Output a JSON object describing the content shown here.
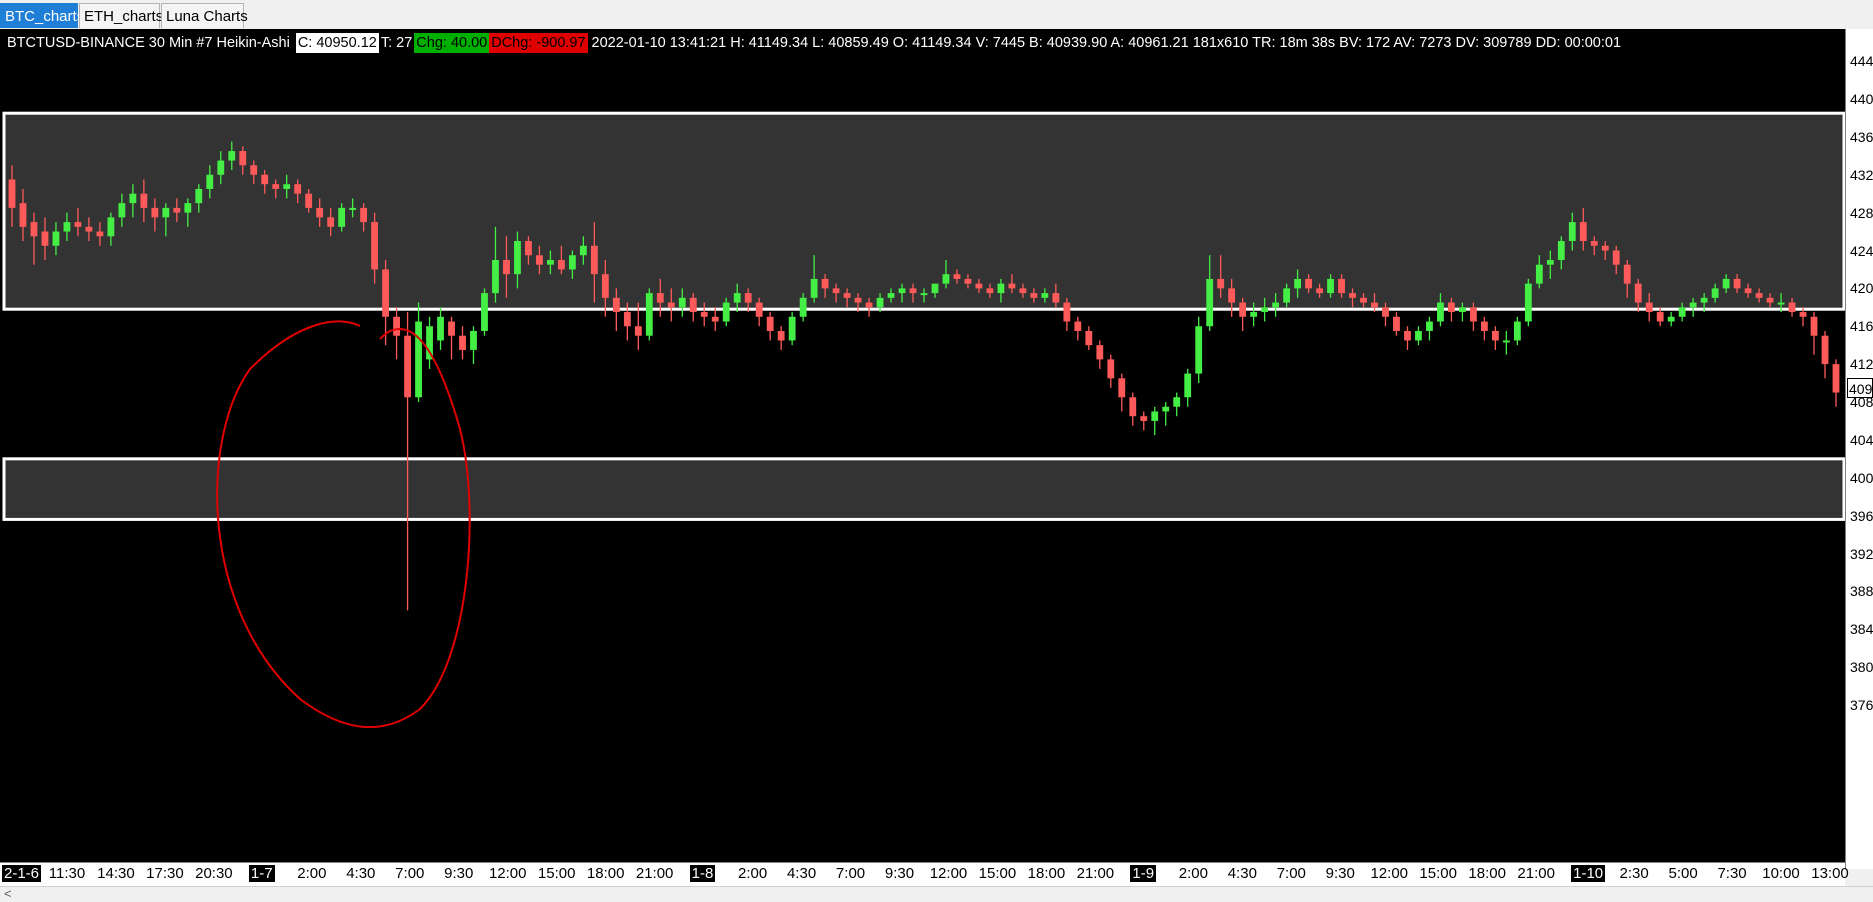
{
  "tabs": [
    {
      "label": "BTC_charts",
      "active": true
    },
    {
      "label": "ETH_charts",
      "active": false
    },
    {
      "label": "Luna Charts",
      "active": false
    }
  ],
  "header": {
    "symbol": "BTCTUSD-BINANCE  30 Min   #7 Heikin-Ashi",
    "close": "C: 40950.12",
    "ticks": "T: 27",
    "chg": "Chg: 40.00",
    "dchg": "DChg: -900.97",
    "details": "2022-01-10 13:41:21 H: 41149.34 L: 40859.49 O: 41149.34 V: 7445 B: 40939.90 A: 40961.21 181x610 TR: 18m 38s BV: 172 AV: 7273 DV: 309789 DD: 00:00:01"
  },
  "colors": {
    "up": "#44ee44",
    "down": "#ff5a5a",
    "zone": "#333333",
    "zone_border": "#ffffff",
    "annotation": "#e00000",
    "background": "#000000"
  },
  "price_axis": {
    "labels": [
      "444",
      "440",
      "436",
      "432",
      "428",
      "424",
      "420",
      "416",
      "412",
      "408",
      "404",
      "400",
      "396",
      "392",
      "388",
      "384",
      "380",
      "376"
    ],
    "current": "409"
  },
  "time_axis": [
    {
      "label": "2-1-6",
      "day": true
    },
    {
      "label": "11:30"
    },
    {
      "label": "14:30"
    },
    {
      "label": "17:30"
    },
    {
      "label": "20:30"
    },
    {
      "label": "1-7",
      "day": true
    },
    {
      "label": "2:00"
    },
    {
      "label": "4:30"
    },
    {
      "label": "7:00"
    },
    {
      "label": "9:30"
    },
    {
      "label": "12:00"
    },
    {
      "label": "15:00"
    },
    {
      "label": "18:00"
    },
    {
      "label": "21:00"
    },
    {
      "label": "1-8",
      "day": true
    },
    {
      "label": "2:00"
    },
    {
      "label": "4:30"
    },
    {
      "label": "7:00"
    },
    {
      "label": "9:30"
    },
    {
      "label": "12:00"
    },
    {
      "label": "15:00"
    },
    {
      "label": "18:00"
    },
    {
      "label": "21:00"
    },
    {
      "label": "1-9",
      "day": true
    },
    {
      "label": "2:00"
    },
    {
      "label": "4:30"
    },
    {
      "label": "7:00"
    },
    {
      "label": "9:30"
    },
    {
      "label": "12:00"
    },
    {
      "label": "15:00"
    },
    {
      "label": "18:00"
    },
    {
      "label": "21:00"
    },
    {
      "label": "1-10",
      "day": true
    },
    {
      "label": "2:30"
    },
    {
      "label": "5:00"
    },
    {
      "label": "7:30"
    },
    {
      "label": "10:00"
    },
    {
      "label": "13:00"
    }
  ],
  "zones": [
    {
      "top": 43850,
      "bottom": 41780
    },
    {
      "top": 40200,
      "bottom": 39560
    }
  ],
  "chart_data": {
    "type": "candlestick",
    "series": [
      {
        "o": 43150,
        "h": 43300,
        "l": 42650,
        "c": 42850
      },
      {
        "o": 42900,
        "h": 43050,
        "l": 42500,
        "c": 42650
      },
      {
        "o": 42700,
        "h": 42800,
        "l": 42250,
        "c": 42550
      },
      {
        "o": 42600,
        "h": 42750,
        "l": 42300,
        "c": 42450
      },
      {
        "o": 42450,
        "h": 42700,
        "l": 42350,
        "c": 42600
      },
      {
        "o": 42600,
        "h": 42800,
        "l": 42500,
        "c": 42700
      },
      {
        "o": 42700,
        "h": 42850,
        "l": 42550,
        "c": 42650
      },
      {
        "o": 42650,
        "h": 42750,
        "l": 42500,
        "c": 42600
      },
      {
        "o": 42600,
        "h": 42700,
        "l": 42450,
        "c": 42550
      },
      {
        "o": 42550,
        "h": 42800,
        "l": 42450,
        "c": 42750
      },
      {
        "o": 42750,
        "h": 43000,
        "l": 42650,
        "c": 42900
      },
      {
        "o": 42900,
        "h": 43100,
        "l": 42750,
        "c": 43000
      },
      {
        "o": 43000,
        "h": 43150,
        "l": 42700,
        "c": 42850
      },
      {
        "o": 42850,
        "h": 42950,
        "l": 42600,
        "c": 42750
      },
      {
        "o": 42750,
        "h": 42900,
        "l": 42550,
        "c": 42850
      },
      {
        "o": 42850,
        "h": 42950,
        "l": 42700,
        "c": 42800
      },
      {
        "o": 42800,
        "h": 42950,
        "l": 42650,
        "c": 42900
      },
      {
        "o": 42900,
        "h": 43100,
        "l": 42800,
        "c": 43050
      },
      {
        "o": 43050,
        "h": 43300,
        "l": 42950,
        "c": 43200
      },
      {
        "o": 43200,
        "h": 43450,
        "l": 43100,
        "c": 43350
      },
      {
        "o": 43350,
        "h": 43550,
        "l": 43250,
        "c": 43450
      },
      {
        "o": 43450,
        "h": 43500,
        "l": 43200,
        "c": 43300
      },
      {
        "o": 43300,
        "h": 43350,
        "l": 43100,
        "c": 43200
      },
      {
        "o": 43200,
        "h": 43250,
        "l": 43000,
        "c": 43100
      },
      {
        "o": 43100,
        "h": 43150,
        "l": 42950,
        "c": 43050
      },
      {
        "o": 43050,
        "h": 43200,
        "l": 42950,
        "c": 43100
      },
      {
        "o": 43100,
        "h": 43150,
        "l": 42900,
        "c": 43000
      },
      {
        "o": 43000,
        "h": 43050,
        "l": 42800,
        "c": 42850
      },
      {
        "o": 42850,
        "h": 42950,
        "l": 42650,
        "c": 42750
      },
      {
        "o": 42750,
        "h": 42850,
        "l": 42550,
        "c": 42650
      },
      {
        "o": 42650,
        "h": 42900,
        "l": 42600,
        "c": 42850
      },
      {
        "o": 42850,
        "h": 42950,
        "l": 42750,
        "c": 42850
      },
      {
        "o": 42850,
        "h": 42900,
        "l": 42600,
        "c": 42700
      },
      {
        "o": 42700,
        "h": 42800,
        "l": 42050,
        "c": 42200
      },
      {
        "o": 42200,
        "h": 42300,
        "l": 41400,
        "c": 41700
      },
      {
        "o": 41700,
        "h": 41800,
        "l": 41250,
        "c": 41500
      },
      {
        "o": 41500,
        "h": 41750,
        "l": 38600,
        "c": 40850
      },
      {
        "o": 40850,
        "h": 41850,
        "l": 40800,
        "c": 41650
      },
      {
        "o": 41250,
        "h": 41700,
        "l": 41150,
        "c": 41600
      },
      {
        "o": 41450,
        "h": 41800,
        "l": 41350,
        "c": 41700
      },
      {
        "o": 41650,
        "h": 41700,
        "l": 41250,
        "c": 41500
      },
      {
        "o": 41500,
        "h": 41600,
        "l": 41250,
        "c": 41350
      },
      {
        "o": 41350,
        "h": 41600,
        "l": 41200,
        "c": 41550
      },
      {
        "o": 41550,
        "h": 42000,
        "l": 41500,
        "c": 41950
      },
      {
        "o": 41950,
        "h": 42650,
        "l": 41850,
        "c": 42300
      },
      {
        "o": 42300,
        "h": 42550,
        "l": 41900,
        "c": 42150
      },
      {
        "o": 42150,
        "h": 42600,
        "l": 42000,
        "c": 42500
      },
      {
        "o": 42500,
        "h": 42550,
        "l": 42250,
        "c": 42350
      },
      {
        "o": 42350,
        "h": 42450,
        "l": 42150,
        "c": 42250
      },
      {
        "o": 42250,
        "h": 42400,
        "l": 42150,
        "c": 42300
      },
      {
        "o": 42300,
        "h": 42450,
        "l": 42150,
        "c": 42200
      },
      {
        "o": 42200,
        "h": 42400,
        "l": 42100,
        "c": 42350
      },
      {
        "o": 42350,
        "h": 42550,
        "l": 42250,
        "c": 42450
      },
      {
        "o": 42450,
        "h": 42700,
        "l": 41850,
        "c": 42150
      },
      {
        "o": 42150,
        "h": 42300,
        "l": 41700,
        "c": 41900
      },
      {
        "o": 41900,
        "h": 42000,
        "l": 41550,
        "c": 41750
      },
      {
        "o": 41750,
        "h": 41850,
        "l": 41450,
        "c": 41600
      },
      {
        "o": 41600,
        "h": 41850,
        "l": 41350,
        "c": 41500
      },
      {
        "o": 41500,
        "h": 42000,
        "l": 41450,
        "c": 41950
      },
      {
        "o": 41950,
        "h": 42100,
        "l": 41700,
        "c": 41850
      },
      {
        "o": 41850,
        "h": 42000,
        "l": 41650,
        "c": 41800
      },
      {
        "o": 41800,
        "h": 42000,
        "l": 41700,
        "c": 41900
      },
      {
        "o": 41900,
        "h": 41950,
        "l": 41650,
        "c": 41750
      },
      {
        "o": 41750,
        "h": 41850,
        "l": 41600,
        "c": 41700
      },
      {
        "o": 41700,
        "h": 41800,
        "l": 41550,
        "c": 41650
      },
      {
        "o": 41650,
        "h": 41900,
        "l": 41600,
        "c": 41850
      },
      {
        "o": 41850,
        "h": 42050,
        "l": 41750,
        "c": 41950
      },
      {
        "o": 41950,
        "h": 42000,
        "l": 41750,
        "c": 41850
      },
      {
        "o": 41850,
        "h": 41900,
        "l": 41600,
        "c": 41700
      },
      {
        "o": 41700,
        "h": 41750,
        "l": 41450,
        "c": 41550
      },
      {
        "o": 41550,
        "h": 41600,
        "l": 41350,
        "c": 41450
      },
      {
        "o": 41450,
        "h": 41750,
        "l": 41400,
        "c": 41700
      },
      {
        "o": 41700,
        "h": 41950,
        "l": 41650,
        "c": 41900
      },
      {
        "o": 41900,
        "h": 42350,
        "l": 41850,
        "c": 42100
      },
      {
        "o": 42100,
        "h": 42150,
        "l": 41900,
        "c": 42000
      },
      {
        "o": 42000,
        "h": 42050,
        "l": 41850,
        "c": 41950
      },
      {
        "o": 41950,
        "h": 42000,
        "l": 41800,
        "c": 41900
      },
      {
        "o": 41900,
        "h": 41950,
        "l": 41750,
        "c": 41850
      },
      {
        "o": 41850,
        "h": 41900,
        "l": 41700,
        "c": 41800
      },
      {
        "o": 41800,
        "h": 41950,
        "l": 41750,
        "c": 41900
      },
      {
        "o": 41900,
        "h": 42000,
        "l": 41850,
        "c": 41950
      },
      {
        "o": 41950,
        "h": 42050,
        "l": 41850,
        "c": 42000
      },
      {
        "o": 42000,
        "h": 42050,
        "l": 41850,
        "c": 41950
      },
      {
        "o": 41950,
        "h": 42000,
        "l": 41850,
        "c": 41950
      },
      {
        "o": 41950,
        "h": 42050,
        "l": 41900,
        "c": 42050
      },
      {
        "o": 42050,
        "h": 42300,
        "l": 42000,
        "c": 42150
      },
      {
        "o": 42150,
        "h": 42200,
        "l": 42050,
        "c": 42100
      },
      {
        "o": 42100,
        "h": 42150,
        "l": 42000,
        "c": 42050
      },
      {
        "o": 42050,
        "h": 42100,
        "l": 41950,
        "c": 42000
      },
      {
        "o": 42000,
        "h": 42050,
        "l": 41900,
        "c": 41950
      },
      {
        "o": 41950,
        "h": 42100,
        "l": 41850,
        "c": 42050
      },
      {
        "o": 42050,
        "h": 42150,
        "l": 41950,
        "c": 42000
      },
      {
        "o": 42000,
        "h": 42050,
        "l": 41900,
        "c": 41950
      },
      {
        "o": 41950,
        "h": 42000,
        "l": 41850,
        "c": 41900
      },
      {
        "o": 41900,
        "h": 42000,
        "l": 41850,
        "c": 41950
      },
      {
        "o": 41950,
        "h": 42050,
        "l": 41800,
        "c": 41850
      },
      {
        "o": 41850,
        "h": 41900,
        "l": 41550,
        "c": 41650
      },
      {
        "o": 41650,
        "h": 41700,
        "l": 41450,
        "c": 41550
      },
      {
        "o": 41550,
        "h": 41600,
        "l": 41350,
        "c": 41400
      },
      {
        "o": 41400,
        "h": 41450,
        "l": 41150,
        "c": 41250
      },
      {
        "o": 41250,
        "h": 41300,
        "l": 40950,
        "c": 41050
      },
      {
        "o": 41050,
        "h": 41100,
        "l": 40700,
        "c": 40850
      },
      {
        "o": 40850,
        "h": 40900,
        "l": 40550,
        "c": 40650
      },
      {
        "o": 40650,
        "h": 40700,
        "l": 40500,
        "c": 40600
      },
      {
        "o": 40600,
        "h": 40750,
        "l": 40450,
        "c": 40700
      },
      {
        "o": 40700,
        "h": 40800,
        "l": 40550,
        "c": 40750
      },
      {
        "o": 40750,
        "h": 40900,
        "l": 40650,
        "c": 40850
      },
      {
        "o": 40850,
        "h": 41150,
        "l": 40750,
        "c": 41100
      },
      {
        "o": 41100,
        "h": 41700,
        "l": 41000,
        "c": 41600
      },
      {
        "o": 41600,
        "h": 42350,
        "l": 41550,
        "c": 42100
      },
      {
        "o": 42100,
        "h": 42350,
        "l": 41900,
        "c": 42000
      },
      {
        "o": 42000,
        "h": 42100,
        "l": 41700,
        "c": 41850
      },
      {
        "o": 41850,
        "h": 41900,
        "l": 41550,
        "c": 41700
      },
      {
        "o": 41700,
        "h": 41850,
        "l": 41600,
        "c": 41750
      },
      {
        "o": 41750,
        "h": 41900,
        "l": 41650,
        "c": 41800
      },
      {
        "o": 41800,
        "h": 41950,
        "l": 41700,
        "c": 41850
      },
      {
        "o": 41850,
        "h": 42050,
        "l": 41800,
        "c": 42000
      },
      {
        "o": 42000,
        "h": 42200,
        "l": 41900,
        "c": 42100
      },
      {
        "o": 42100,
        "h": 42150,
        "l": 41950,
        "c": 42000
      },
      {
        "o": 42000,
        "h": 42050,
        "l": 41900,
        "c": 41950
      },
      {
        "o": 41950,
        "h": 42150,
        "l": 41900,
        "c": 42100
      },
      {
        "o": 42100,
        "h": 42150,
        "l": 41900,
        "c": 41950
      },
      {
        "o": 41950,
        "h": 42000,
        "l": 41800,
        "c": 41900
      },
      {
        "o": 41900,
        "h": 41950,
        "l": 41800,
        "c": 41850
      },
      {
        "o": 41850,
        "h": 41950,
        "l": 41750,
        "c": 41800
      },
      {
        "o": 41800,
        "h": 41850,
        "l": 41600,
        "c": 41700
      },
      {
        "o": 41700,
        "h": 41750,
        "l": 41500,
        "c": 41550
      },
      {
        "o": 41550,
        "h": 41600,
        "l": 41350,
        "c": 41450
      },
      {
        "o": 41450,
        "h": 41600,
        "l": 41400,
        "c": 41550
      },
      {
        "o": 41550,
        "h": 41700,
        "l": 41450,
        "c": 41650
      },
      {
        "o": 41650,
        "h": 41950,
        "l": 41600,
        "c": 41850
      },
      {
        "o": 41850,
        "h": 41900,
        "l": 41650,
        "c": 41750
      },
      {
        "o": 41750,
        "h": 41850,
        "l": 41650,
        "c": 41800
      },
      {
        "o": 41800,
        "h": 41850,
        "l": 41550,
        "c": 41650
      },
      {
        "o": 41650,
        "h": 41700,
        "l": 41450,
        "c": 41550
      },
      {
        "o": 41550,
        "h": 41600,
        "l": 41350,
        "c": 41450
      },
      {
        "o": 41450,
        "h": 41550,
        "l": 41300,
        "c": 41450
      },
      {
        "o": 41450,
        "h": 41700,
        "l": 41400,
        "c": 41650
      },
      {
        "o": 41650,
        "h": 42100,
        "l": 41600,
        "c": 42050
      },
      {
        "o": 42050,
        "h": 42350,
        "l": 42000,
        "c": 42250
      },
      {
        "o": 42250,
        "h": 42400,
        "l": 42100,
        "c": 42300
      },
      {
        "o": 42300,
        "h": 42550,
        "l": 42200,
        "c": 42500
      },
      {
        "o": 42500,
        "h": 42800,
        "l": 42400,
        "c": 42700
      },
      {
        "o": 42700,
        "h": 42850,
        "l": 42400,
        "c": 42500
      },
      {
        "o": 42500,
        "h": 42550,
        "l": 42350,
        "c": 42450
      },
      {
        "o": 42450,
        "h": 42500,
        "l": 42300,
        "c": 42400
      },
      {
        "o": 42400,
        "h": 42450,
        "l": 42150,
        "c": 42250
      },
      {
        "o": 42250,
        "h": 42300,
        "l": 41900,
        "c": 42050
      },
      {
        "o": 42050,
        "h": 42100,
        "l": 41750,
        "c": 41850
      },
      {
        "o": 41850,
        "h": 41950,
        "l": 41650,
        "c": 41750
      },
      {
        "o": 41750,
        "h": 41800,
        "l": 41600,
        "c": 41650
      },
      {
        "o": 41650,
        "h": 41750,
        "l": 41600,
        "c": 41700
      },
      {
        "o": 41700,
        "h": 41850,
        "l": 41650,
        "c": 41800
      },
      {
        "o": 41800,
        "h": 41900,
        "l": 41700,
        "c": 41850
      },
      {
        "o": 41850,
        "h": 41950,
        "l": 41750,
        "c": 41900
      },
      {
        "o": 41900,
        "h": 42050,
        "l": 41850,
        "c": 42000
      },
      {
        "o": 42000,
        "h": 42150,
        "l": 41950,
        "c": 42100
      },
      {
        "o": 42100,
        "h": 42150,
        "l": 41950,
        "c": 42000
      },
      {
        "o": 42000,
        "h": 42050,
        "l": 41900,
        "c": 41950
      },
      {
        "o": 41950,
        "h": 42000,
        "l": 41850,
        "c": 41900
      },
      {
        "o": 41900,
        "h": 41950,
        "l": 41800,
        "c": 41850
      },
      {
        "o": 41850,
        "h": 41950,
        "l": 41750,
        "c": 41850
      },
      {
        "o": 41850,
        "h": 41900,
        "l": 41700,
        "c": 41750
      },
      {
        "o": 41750,
        "h": 41800,
        "l": 41600,
        "c": 41700
      },
      {
        "o": 41700,
        "h": 41750,
        "l": 41300,
        "c": 41500
      },
      {
        "o": 41500,
        "h": 41550,
        "l": 41050,
        "c": 41200
      },
      {
        "o": 41200,
        "h": 41250,
        "l": 40750,
        "c": 40900
      }
    ],
    "ylim": [
      37500,
      44700
    ]
  }
}
